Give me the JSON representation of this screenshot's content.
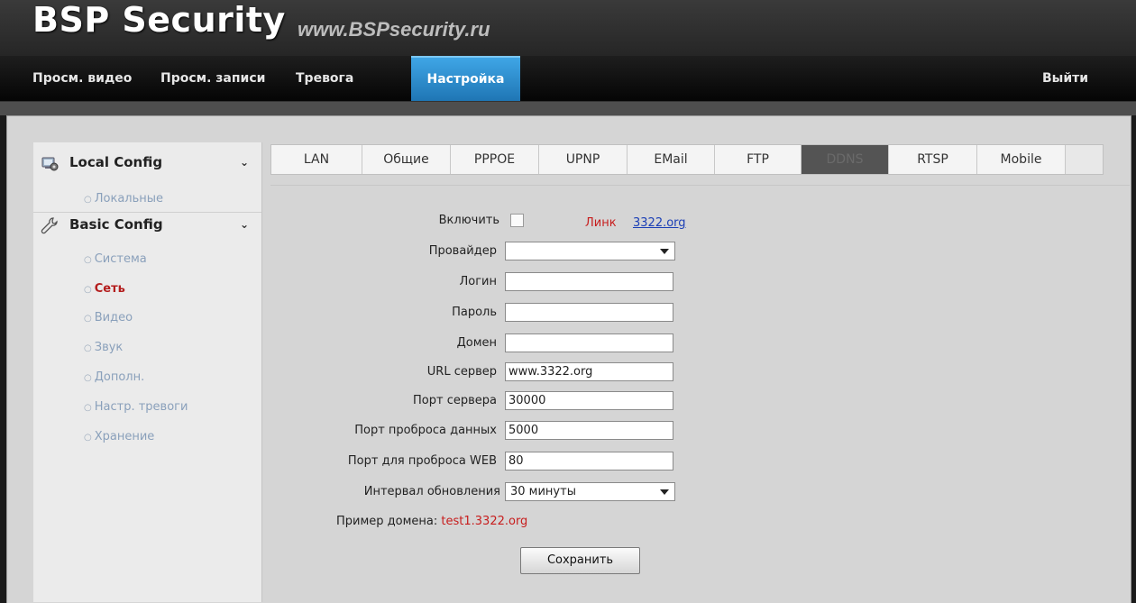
{
  "header": {
    "brand": "BSP Security",
    "website": "www.BSPsecurity.ru"
  },
  "nav": {
    "items": [
      {
        "label": "Просм. видео"
      },
      {
        "label": "Просм. записи"
      },
      {
        "label": "Тревога"
      },
      {
        "label": "Настройка",
        "active": true
      }
    ],
    "logout": "Выйти"
  },
  "sidebar": {
    "local": {
      "title": "Local Config",
      "items": [
        {
          "label": "Локальные"
        }
      ]
    },
    "basic": {
      "title": "Basic Config",
      "items": [
        {
          "label": "Система"
        },
        {
          "label": "Сеть",
          "active": true
        },
        {
          "label": "Видео"
        },
        {
          "label": "Звук"
        },
        {
          "label": "Дополн."
        },
        {
          "label": "Настр. тревоги"
        },
        {
          "label": "Хранение"
        }
      ]
    }
  },
  "tabs": [
    {
      "label": "LAN"
    },
    {
      "label": "Общие"
    },
    {
      "label": "PPPOE"
    },
    {
      "label": "UPNP"
    },
    {
      "label": "EMail"
    },
    {
      "label": "FTP"
    },
    {
      "label": "DDNS",
      "active": true
    },
    {
      "label": "RTSP"
    },
    {
      "label": "Mobile"
    }
  ],
  "form": {
    "enable_label": "Включить",
    "enable_checked": false,
    "link_label": "Линк",
    "link_text": "3322.org",
    "provider_label": "Провайдер",
    "provider_value": "",
    "login_label": "Логин",
    "login_value": "",
    "password_label": "Пароль",
    "password_value": "",
    "domain_label": "Домен",
    "domain_value": "",
    "server_url_label": "URL сервер",
    "server_url_value": "www.3322.org",
    "server_port_label": "Порт сервера",
    "server_port_value": "30000",
    "data_port_label": "Порт проброса данных",
    "data_port_value": "5000",
    "web_port_label": "Порт для проброса WEB",
    "web_port_value": "80",
    "interval_label": "Интервал обновления",
    "interval_value": "30 минуты",
    "example_label": "Пример домена:",
    "example_value": "test1.3322.org",
    "save_label": "Сохранить"
  }
}
